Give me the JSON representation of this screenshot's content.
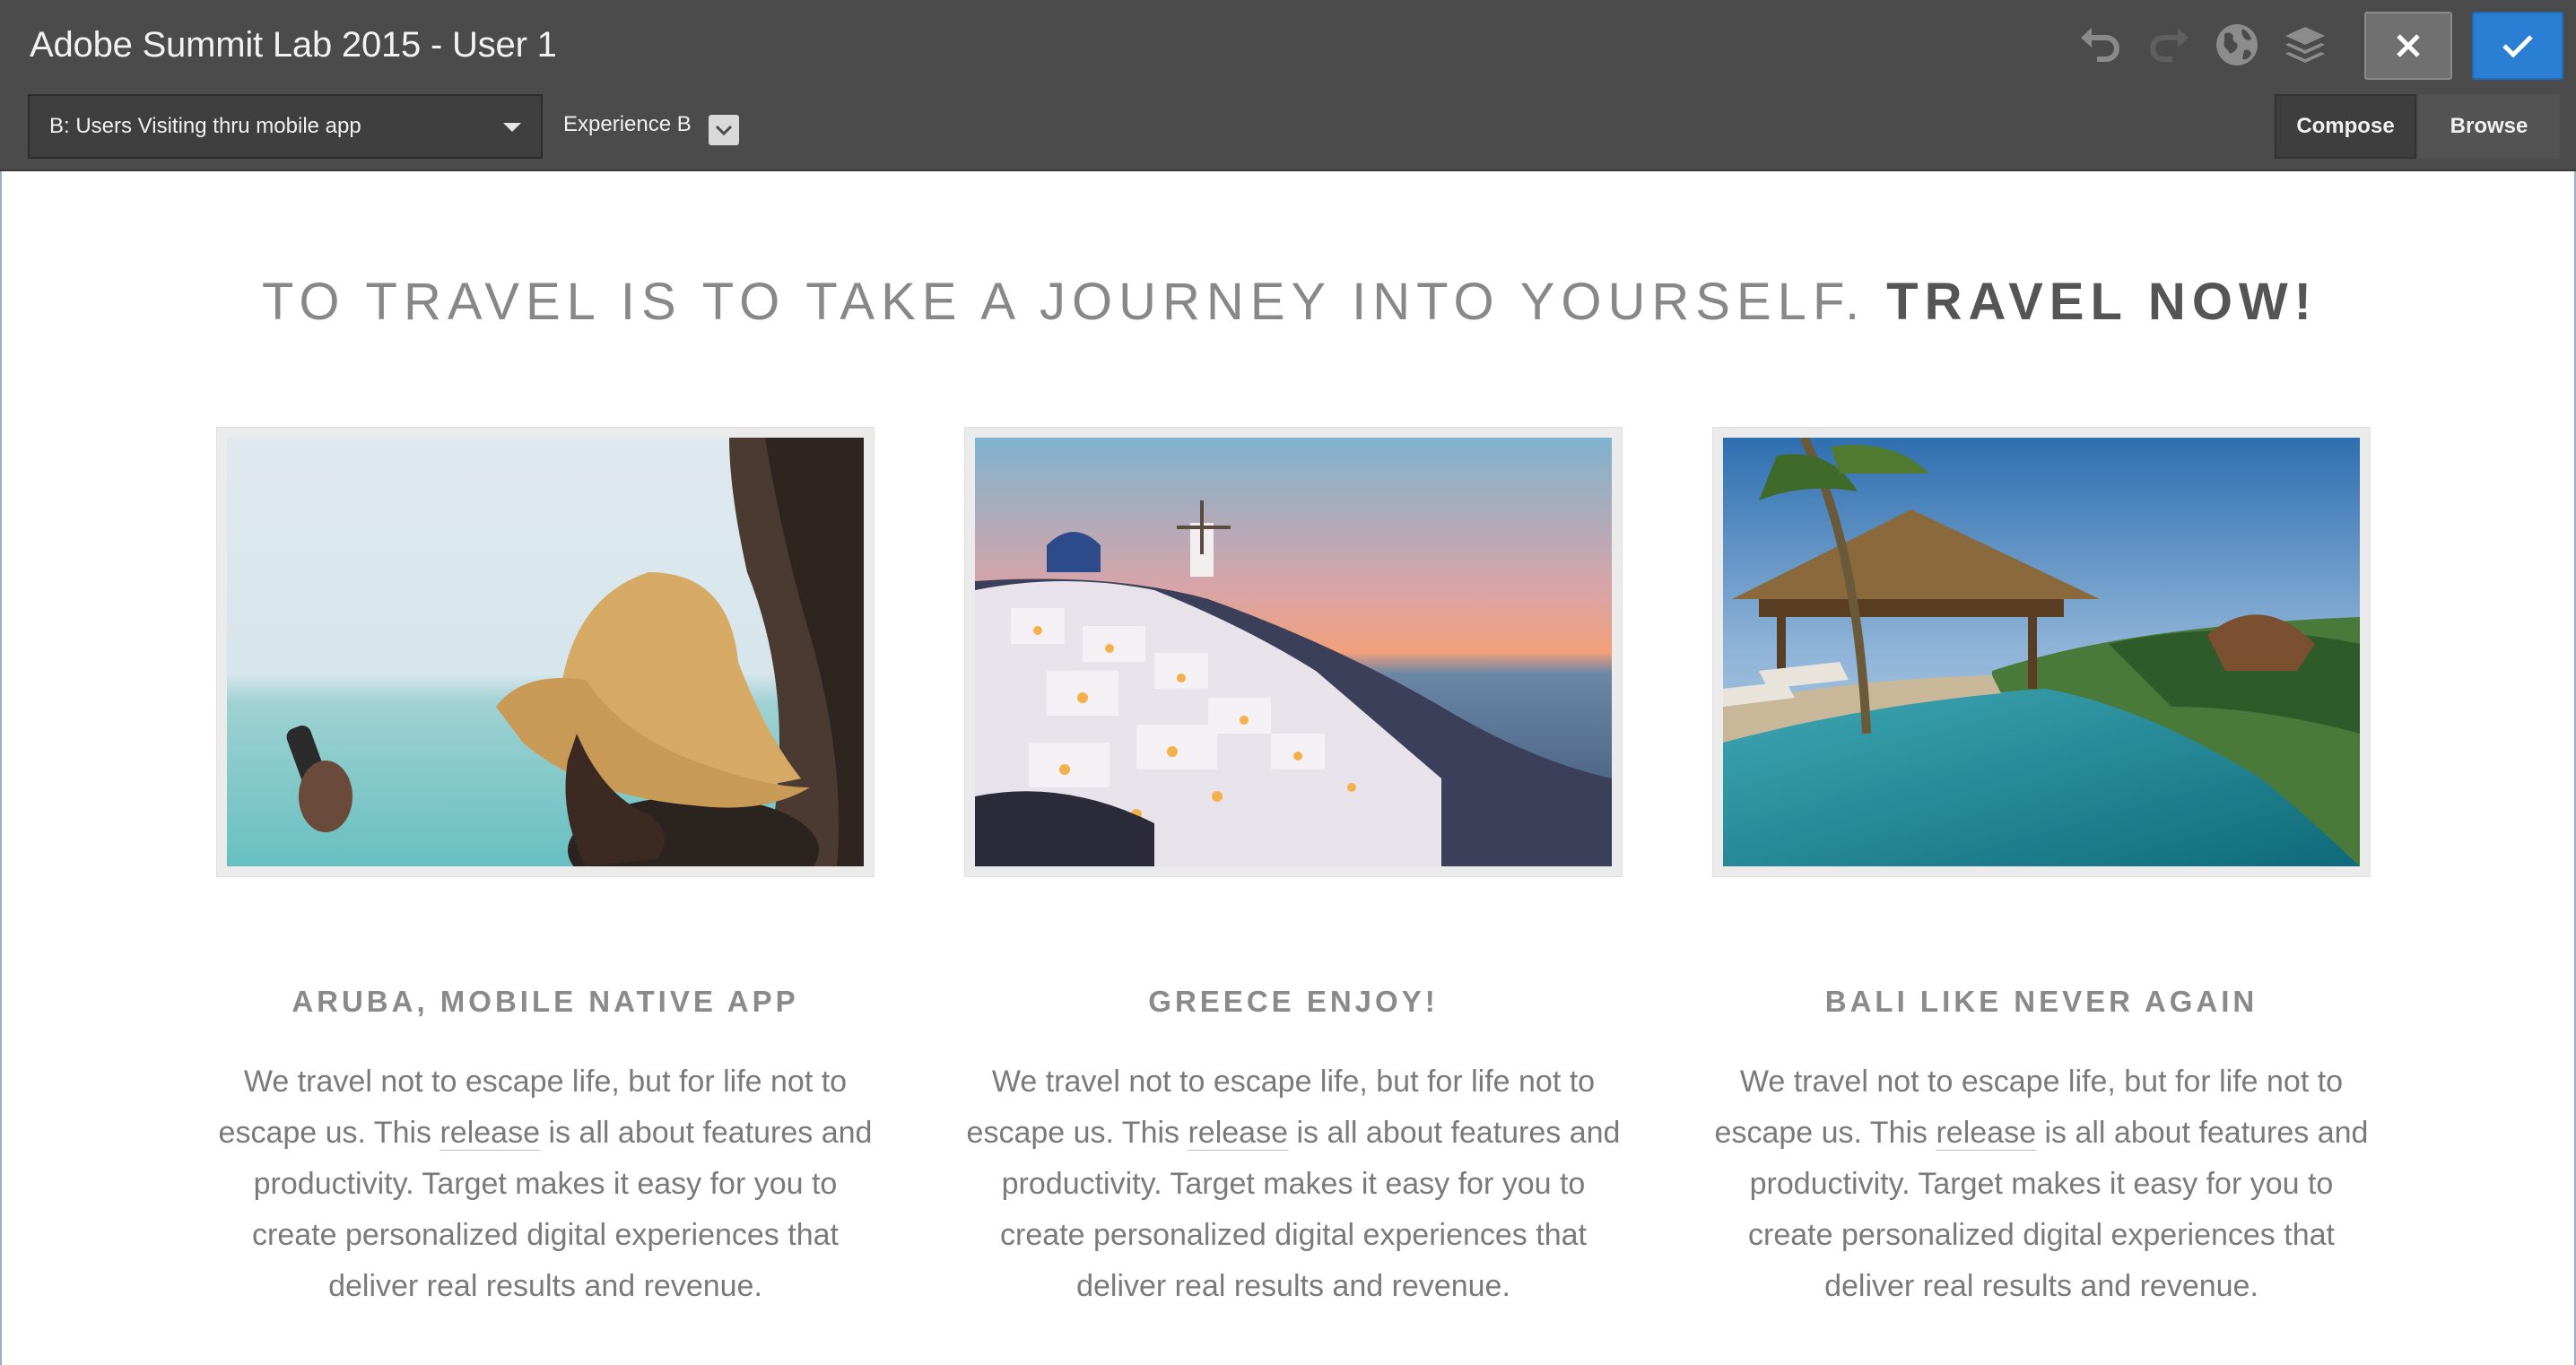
{
  "app": {
    "title": "Adobe Summit Lab 2015 - User 1"
  },
  "toolbar": {
    "audience_selected": "B: Users Visiting thru mobile app",
    "experience_label": "Experience B",
    "icons": [
      "undo-icon",
      "redo-icon",
      "globe-icon",
      "layers-icon"
    ],
    "close_icon": "close-icon",
    "confirm_icon": "check-icon",
    "tabs": [
      {
        "label": "Compose"
      },
      {
        "label": "Browse"
      }
    ],
    "confirm_color": "#2a7fd4"
  },
  "page": {
    "heading_main": "TO TRAVEL IS TO TAKE A JOURNEY INTO YOURSELF. ",
    "heading_accent": "TRAVEL NOW!",
    "cards": [
      {
        "title": "ARUBA, MOBILE NATIVE APP",
        "image": "woman-in-straw-hat-with-phone",
        "body_before": "We travel not to escape life, but for life not to escape us. This ",
        "body_link": "release",
        "body_after": " is all about features and productivity. Target makes it easy for you to create personalized digital experiences that deliver real results and revenue."
      },
      {
        "title": "GREECE ENJOY!",
        "image": "santorini-village-sunset",
        "body_before": "We travel not to escape life, but for life not to escape us. This ",
        "body_link": "release",
        "body_after": " is all about features and productivity. Target makes it easy for you to create personalized digital experiences that deliver real results and revenue."
      },
      {
        "title": "BALI LIKE NEVER AGAIN",
        "image": "infinity-pool-with-thatched-roof",
        "body_before": "We travel not to escape life, but for life not to escape us. This ",
        "body_link": "release",
        "body_after": " is all about features and productivity. Target makes it easy for you to create personalized digital experiences that deliver real results and revenue."
      }
    ]
  }
}
